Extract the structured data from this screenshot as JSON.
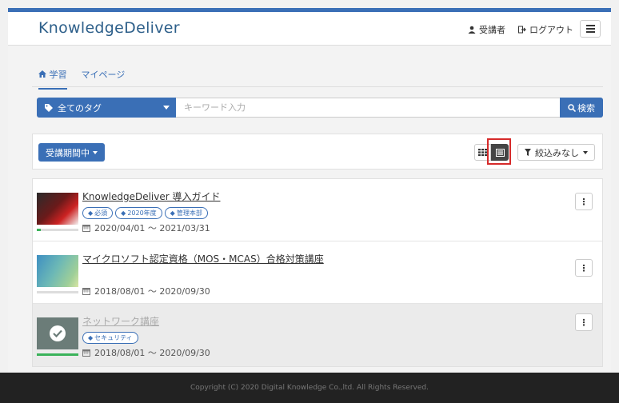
{
  "header": {
    "logo_part1": "Knowledge",
    "logo_part2": "Deliver",
    "user_label": "受講者",
    "logout_label": "ログアウト"
  },
  "tabs": [
    {
      "label": "学習",
      "active": true
    },
    {
      "label": "マイページ",
      "active": false
    }
  ],
  "search": {
    "tag_select": "全てのタグ",
    "placeholder": "キーワード入力",
    "button_label": "検索"
  },
  "toolbar": {
    "period_label": "受講期間中",
    "filter_label": "絞込みなし"
  },
  "courses": [
    {
      "title": "KnowledgeDeliver 導入ガイド",
      "tags": [
        "必須",
        "2020年度",
        "管理本部"
      ],
      "date": "2020/04/01 ～ 2021/03/31",
      "progress": 0.1,
      "completed": false
    },
    {
      "title": "マイクロソフト認定資格（MOS・MCAS）合格対策講座",
      "tags": [],
      "date": "2018/08/01 ～ 2020/09/30",
      "progress": 0,
      "completed": false
    },
    {
      "title": "ネットワーク講座",
      "tags": [
        "セキュリティ"
      ],
      "date": "2018/08/01 ～ 2020/09/30",
      "progress": 1.0,
      "completed": true
    }
  ],
  "footer": {
    "copyright": "Copyright (C) 2020 Digital Knowledge Co.,ltd. All Rights Reserved."
  },
  "colors": {
    "primary": "#3a6fb6",
    "highlight": "#d62a2a",
    "progress": "#3bb35a",
    "footer_bg": "#222222"
  }
}
